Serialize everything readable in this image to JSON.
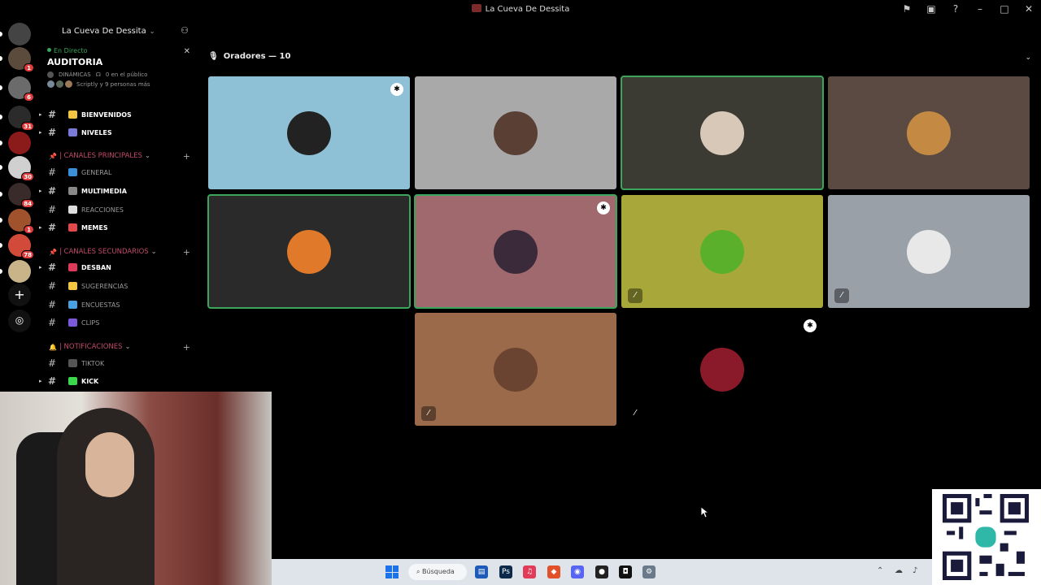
{
  "window": {
    "title": "La Cueva De Dessita",
    "controls": [
      "flag-icon",
      "inbox-icon",
      "help-icon",
      "minimize-icon",
      "maximize-icon",
      "close-icon"
    ]
  },
  "server_rail": {
    "servers": [
      {
        "color": "#444444",
        "badge": ""
      },
      {
        "color": "#5a4b3c",
        "badge": "1"
      },
      {
        "color": "#6b6b6b",
        "badge": "6"
      },
      {
        "color": "#2b2b2b",
        "badge": "31"
      },
      {
        "color": "#8b1a1a",
        "badge": ""
      },
      {
        "color": "#d0d0d0",
        "badge": "30"
      },
      {
        "color": "#3a2b2b",
        "badge": "84"
      },
      {
        "color": "#a0522d",
        "badge": "1"
      },
      {
        "color": "#d14a3a",
        "badge": "78"
      },
      {
        "color": "#c9b48a",
        "badge": ""
      }
    ],
    "add_server_icon": "plus-icon",
    "discover_icon": "compass-icon"
  },
  "sidebar": {
    "server_name": "La Cueva De Dessita",
    "voice": {
      "status": "En Directo",
      "channel_name": "AUDITORIA",
      "meta_left": "DINÁMICAS",
      "meta_right": "0 en el público",
      "people": "Scriptly y 9 personas más"
    },
    "categories": [
      {
        "label": "| CANALES PRINCIPALES",
        "icon": "pin-icon"
      },
      {
        "label": "| CANALES SECUNDARIOS",
        "icon": "pin-icon"
      },
      {
        "label": "| NOTIFICACIONES",
        "icon": "bell-icon"
      }
    ],
    "channels": [
      {
        "label": "BIENVENIDOS",
        "bold": true,
        "color": "#f4c542"
      },
      {
        "label": "NIVELES",
        "bold": true,
        "color": "#7a7ad8"
      },
      {
        "label": "GENERAL",
        "bold": false,
        "color": "#3b8ed8"
      },
      {
        "label": "MULTIMEDIA",
        "bold": true,
        "color": "#888888"
      },
      {
        "label": "REACCIONES",
        "bold": false,
        "color": "#dddddd"
      },
      {
        "label": "MEMES",
        "bold": true,
        "color": "#e04a4a"
      },
      {
        "label": "DESBAN",
        "bold": true,
        "color": "#e03a5a"
      },
      {
        "label": "SUGERENCIAS",
        "bold": false,
        "color": "#f4c542"
      },
      {
        "label": "ENCUESTAS",
        "bold": false,
        "color": "#4aa0e0"
      },
      {
        "label": "CLIPS",
        "bold": false,
        "color": "#7a5ad8"
      },
      {
        "label": "TIKTOK",
        "bold": false,
        "color": "#555555"
      },
      {
        "label": "KICK",
        "bold": true,
        "color": "#3ad84a"
      }
    ]
  },
  "main": {
    "speakers_label": "Oradores — 10",
    "tiles": [
      {
        "bg": "#8ec0d6",
        "avatar": "#222222",
        "speaking": false,
        "moderator": true,
        "muted": false
      },
      {
        "bg": "#a9a9a9",
        "avatar": "#5a4034",
        "speaking": false,
        "moderator": false,
        "muted": false
      },
      {
        "bg": "#3b3b33",
        "avatar": "#d8c8b8",
        "speaking": true,
        "moderator": false,
        "muted": false
      },
      {
        "bg": "#5a4a42",
        "avatar": "#c48a44",
        "speaking": false,
        "moderator": false,
        "muted": false
      },
      {
        "bg": "#2a2a2a",
        "avatar": "#e07a2a",
        "speaking": true,
        "moderator": false,
        "muted": false
      },
      {
        "bg": "#a0696e",
        "avatar": "#3a2a3a",
        "speaking": true,
        "moderator": true,
        "muted": false
      },
      {
        "bg": "#a8a83a",
        "avatar": "#5ab02a",
        "speaking": false,
        "moderator": false,
        "muted": true
      },
      {
        "bg": "#9aa0a8",
        "avatar": "#e8e8e8",
        "speaking": false,
        "moderator": false,
        "muted": true
      },
      {
        "bg": "#9a6a4a",
        "avatar": "#6a4430",
        "speaking": false,
        "moderator": false,
        "muted": true
      },
      {
        "bg": "#000000",
        "avatar": "#8a1a2a",
        "speaking": false,
        "moderator": true,
        "muted": true
      }
    ]
  },
  "taskbar": {
    "search_label": "Búsqueda",
    "apps": [
      {
        "icon": "file-explorer-icon",
        "color": "#1e5bb8",
        "glyph": "▤"
      },
      {
        "icon": "photoshop-icon",
        "color": "#0b2a4a",
        "glyph": "Ps"
      },
      {
        "icon": "music-icon",
        "color": "#e23b5a",
        "glyph": "♫"
      },
      {
        "icon": "brave-icon",
        "color": "#e2502a",
        "glyph": "◆"
      },
      {
        "icon": "discord-icon",
        "color": "#5865f2",
        "glyph": "◉"
      },
      {
        "icon": "obs-icon",
        "color": "#222222",
        "glyph": "●"
      },
      {
        "icon": "capcut-icon",
        "color": "#111111",
        "glyph": "◘"
      },
      {
        "icon": "settings-icon",
        "color": "#6a7a8a",
        "glyph": "⚙"
      }
    ]
  }
}
